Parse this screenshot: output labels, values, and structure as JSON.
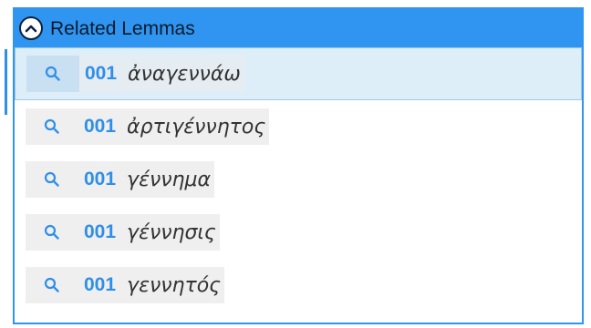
{
  "panel": {
    "title": "Related Lemmas",
    "accent_color": "#2f95f0",
    "toggle_icon": "chevron-up-icon"
  },
  "rows": [
    {
      "count": "001",
      "lemma": "ἀναγεννάω",
      "icon": "search-icon",
      "selected": true
    },
    {
      "count": "001",
      "lemma": "ἀρτιγέννητος",
      "icon": "search-icon",
      "selected": false
    },
    {
      "count": "001",
      "lemma": "γέννημα",
      "icon": "search-icon",
      "selected": false
    },
    {
      "count": "001",
      "lemma": "γέννησις",
      "icon": "search-icon",
      "selected": false
    },
    {
      "count": "001",
      "lemma": "γεννητός",
      "icon": "search-icon",
      "selected": false
    }
  ]
}
